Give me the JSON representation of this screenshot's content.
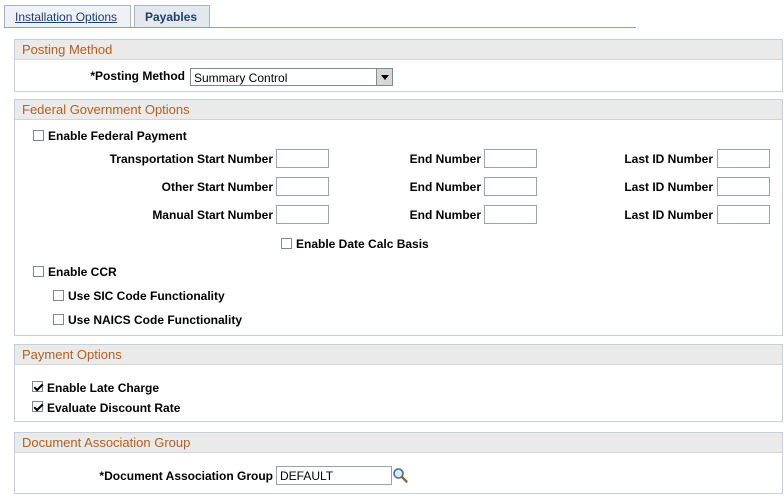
{
  "tabs": [
    {
      "label": "Installation Options"
    },
    {
      "label": "Payables"
    }
  ],
  "posting": {
    "header": "Posting Method",
    "label": "*Posting Method",
    "value": "Summary Control"
  },
  "federal": {
    "header": "Federal Government Options",
    "enable_payment": "Enable Federal Payment",
    "rows": [
      {
        "start_label": "Transportation Start Number",
        "end_label": "End Number",
        "last_label": "Last ID Number"
      },
      {
        "start_label": "Other Start Number",
        "end_label": "End Number",
        "last_label": "Last ID Number"
      },
      {
        "start_label": "Manual Start Number",
        "end_label": "End Number",
        "last_label": "Last ID Number"
      }
    ],
    "date_calc": "Enable Date Calc Basis",
    "enable_ccr": "Enable CCR",
    "sic": "Use SIC Code Functionality",
    "naics": "Use NAICS Code Functionality"
  },
  "payment": {
    "header": "Payment Options",
    "late_charge": "Enable Late Charge",
    "late_charge_checked": true,
    "discount_rate": "Evaluate Discount Rate",
    "discount_rate_checked": true
  },
  "docgroup": {
    "header": "Document Association Group",
    "label": "*Document Association Group",
    "value": "DEFAULT"
  },
  "icons": {
    "lookup": "magnifier-lookup-icon",
    "dropdown": "chevron-down-icon"
  }
}
